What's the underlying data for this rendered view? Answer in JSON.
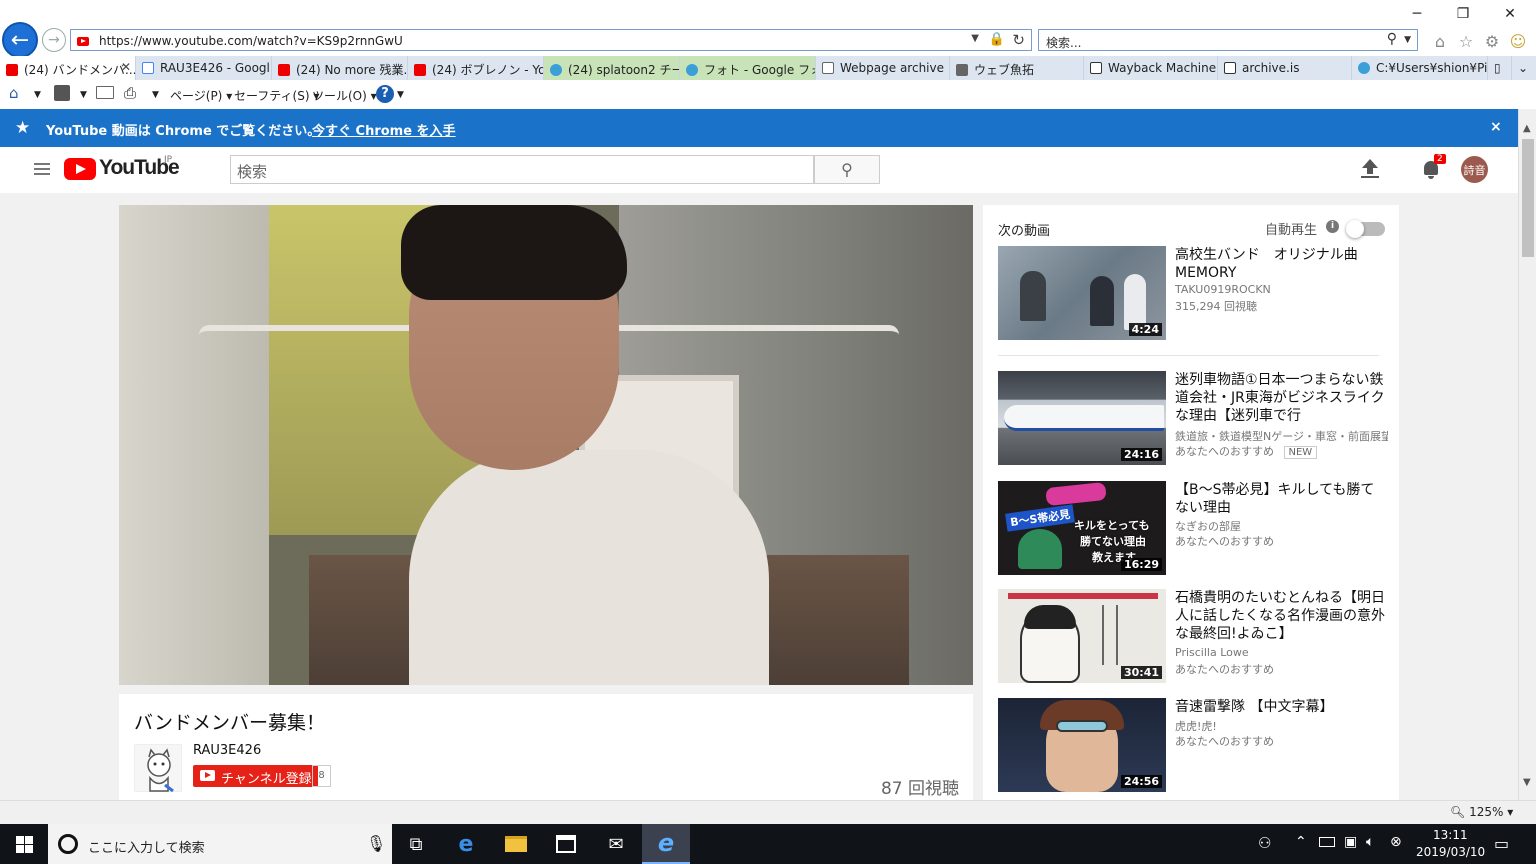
{
  "browser": {
    "url": "https://www.youtube.com/watch?v=KS9p2rnnGwU",
    "search_placeholder": "検索...",
    "tabs": [
      {
        "label": "(24) バンドメンバ...",
        "favicon": "youtube",
        "active": true
      },
      {
        "label": "RAU3E426 - Googl...",
        "favicon": "google"
      },
      {
        "label": "(24) No more 残業...",
        "favicon": "youtube"
      },
      {
        "label": "(24) ボブレノン - You...",
        "favicon": "youtube"
      },
      {
        "label": "(24) splatoon2 チー...",
        "favicon": "ie"
      },
      {
        "label": "フォト - Google フォト",
        "favicon": "ie"
      },
      {
        "label": "Webpage archive",
        "favicon": "page"
      },
      {
        "label": "ウェブ魚拓",
        "favicon": "gyotaku"
      },
      {
        "label": "Wayback Machine",
        "favicon": "page"
      },
      {
        "label": "archive.is",
        "favicon": "page"
      },
      {
        "label": "C:¥Users¥shion¥Pi...",
        "favicon": "ie"
      }
    ],
    "commands": {
      "page": "ページ(P)",
      "safety": "セーフティ(S)",
      "tools": "ツール(O)"
    },
    "zoom": "125%"
  },
  "infobar": {
    "message": "YouTube 動画は Chrome でご覧ください。",
    "link": "今すぐ Chrome を入手",
    "close": "×"
  },
  "youtube": {
    "logo_text": "YouTube",
    "region": "JP",
    "search_placeholder": "検索",
    "notification_count": "2",
    "avatar_text": "詩音"
  },
  "video": {
    "title": "バンドメンバー募集！",
    "channel": "RAU3E426",
    "subscribe_label": "チャンネル登録",
    "subscriber_count": "8",
    "views": "87 回視聴"
  },
  "sidebar": {
    "heading": "次の動画",
    "autoplay_label": "自動再生",
    "items": [
      {
        "title": "高校生バンド　オリジナル曲 MEMORY",
        "channel": "TAKU0919ROCKN",
        "meta": "315,294 回視聴",
        "duration": "4:24",
        "badge": ""
      },
      {
        "title": "迷列車物語①日本一つまらない鉄道会社・JR東海がビジネスライクな理由【迷列車で行",
        "channel": "鉄道旅・鉄道模型Nゲージ・車窓・前面展望",
        "meta": "あなたへのおすすめ",
        "duration": "24:16",
        "badge": "NEW"
      },
      {
        "title": "【B～S帯必見】キルしても勝てない理由",
        "channel": "なぎおの部屋",
        "meta": "あなたへのおすすめ",
        "duration": "16:29",
        "badge": ""
      },
      {
        "title": "石橋貴明のたいむとんねる【明日人に話したくなる名作漫画の意外な最終回!よゐこ】",
        "channel": "Priscilla Lowe",
        "meta": "あなたへのおすすめ",
        "duration": "30:41",
        "badge": ""
      },
      {
        "title": "音速雷撃隊 【中文字幕】",
        "channel": "虎虎!虎!",
        "meta": "あなたへのおすすめ",
        "duration": "24:56",
        "badge": ""
      }
    ],
    "thumb_text": {
      "splat_line1": "B～S帯必見",
      "splat_line2": "キルをとっても",
      "splat_line3": "勝てない理由",
      "splat_line4": "教えます"
    }
  },
  "taskbar": {
    "search_placeholder": "ここに入力して検索",
    "time": "13:11",
    "date": "2019/03/10"
  },
  "colors": {
    "accent": "#1a73c8",
    "youtube_red": "#ff0000",
    "taskbar": "#101418"
  }
}
